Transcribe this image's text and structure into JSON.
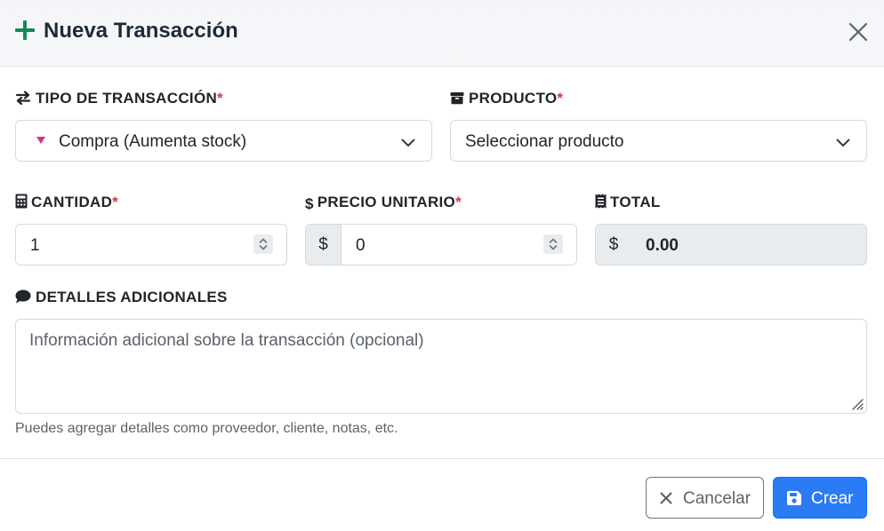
{
  "modal": {
    "title": "Nueva Transacción"
  },
  "fields": {
    "tipo": {
      "label": "TIPO DE TRANSACCIÓN",
      "required_mark": "*",
      "selected": "Compra (Aumenta stock)",
      "indicator_color": "#d63384"
    },
    "producto": {
      "label": "PRODUCTO",
      "required_mark": "*",
      "selected": "Seleccionar producto"
    },
    "cantidad": {
      "label": "CANTIDAD",
      "required_mark": "*",
      "value": "1"
    },
    "precio": {
      "label": "PRECIO UNITARIO",
      "required_mark": "*",
      "prefix_icon": "$",
      "currency": "$",
      "value": "0"
    },
    "total": {
      "label": "TOTAL",
      "currency": "$",
      "value": "0.00"
    },
    "detalles": {
      "label": "DETALLES ADICIONALES",
      "placeholder": "Información adicional sobre la transacción (opcional)",
      "help": "Puedes agregar detalles como proveedor, cliente, notas, etc."
    }
  },
  "buttons": {
    "cancel": "Cancelar",
    "create": "Crear"
  },
  "colors": {
    "accent": "#2b7bf5",
    "success": "#198754",
    "required": "#dc3545"
  },
  "icons": {
    "header": "plus-icon",
    "close": "close-icon",
    "tipo": "exchange-icon",
    "producto": "box-icon",
    "cantidad": "calculator-icon",
    "precio": "dollar-icon",
    "total": "receipt-icon",
    "detalles": "comment-icon",
    "cancel": "x-icon",
    "create": "save-icon"
  }
}
